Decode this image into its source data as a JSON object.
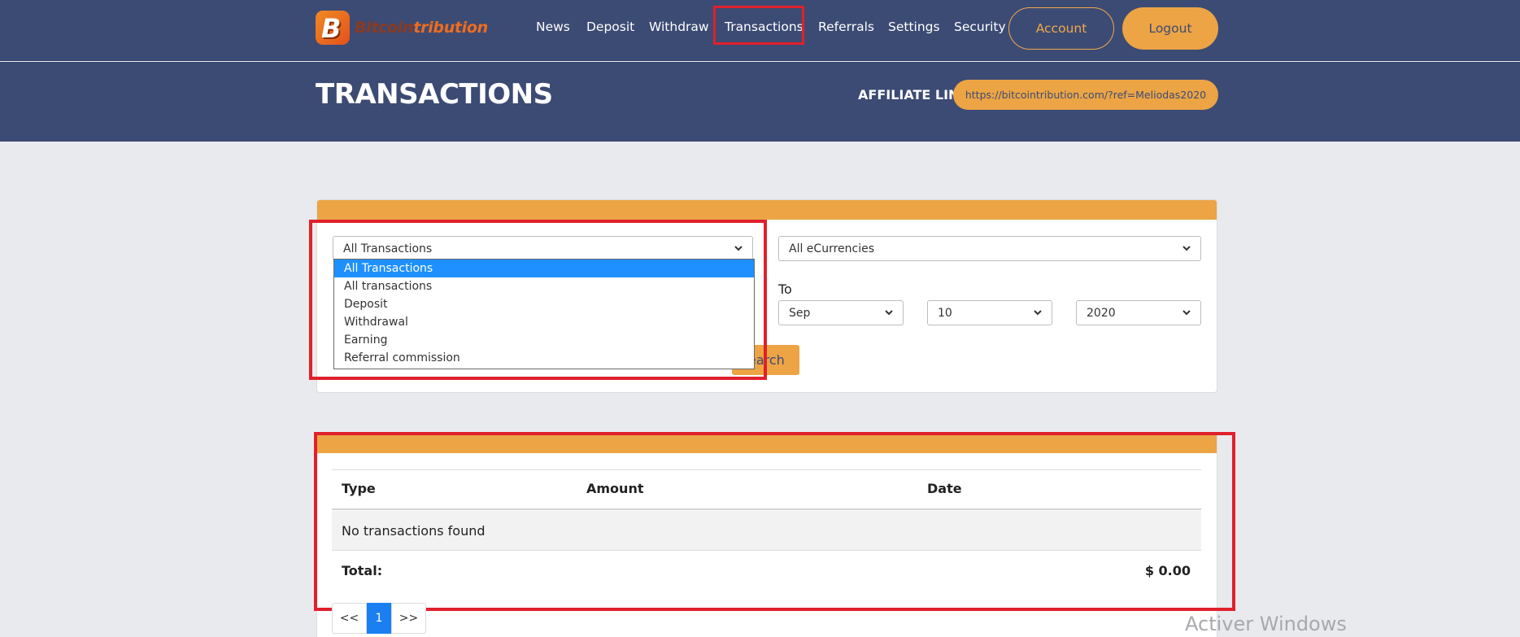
{
  "brand": {
    "part1": "Bitcoin",
    "part2": "tribution",
    "badge_letter": "B"
  },
  "nav": {
    "items": [
      {
        "label": "News"
      },
      {
        "label": "Deposit"
      },
      {
        "label": "Withdraw"
      },
      {
        "label": "Transactions"
      },
      {
        "label": "Referrals"
      },
      {
        "label": "Settings"
      },
      {
        "label": "Security"
      }
    ],
    "active": "Transactions",
    "account_label": "Account",
    "logout_label": "Logout"
  },
  "page": {
    "title": "TRANSACTIONS",
    "affiliate_label": "AFFILIATE LINK:",
    "affiliate_url": "https://bitcointribution.com/?ref=Meliodas2020"
  },
  "filters": {
    "type_select": {
      "selected": "All Transactions"
    },
    "type_options": [
      "All Transactions",
      "All transactions",
      "Deposit",
      "Withdrawal",
      "Earning",
      "Referral commission"
    ],
    "currency_select": {
      "selected": "All eCurrencies"
    },
    "to_label": "To",
    "to_month": "Sep",
    "to_day": "10",
    "to_year": "2020",
    "search_label": "earch"
  },
  "table": {
    "columns": [
      "Type",
      "Amount",
      "Date"
    ],
    "empty_message": "No transactions found",
    "total_label": "Total:",
    "total_value": "$ 0.00"
  },
  "pagination": {
    "prev": "<<",
    "current": "1",
    "next": ">>"
  },
  "watermark": "Activer Windows",
  "colors": {
    "header_bg": "#3c4b74",
    "accent": "#eca445",
    "highlight": "#e0202b",
    "page_bg": "#e9eaee"
  }
}
